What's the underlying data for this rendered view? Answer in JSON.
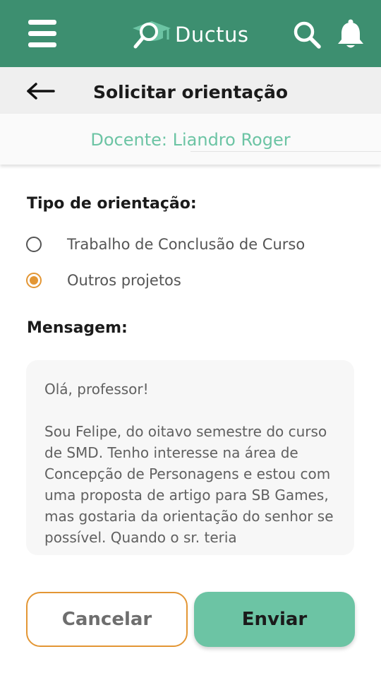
{
  "app": {
    "name": "Ductus"
  },
  "header": {
    "menu_icon": "hamburger-menu-icon",
    "logo_icon": "magnifier-graduation-cap-icon",
    "search_icon": "search-icon",
    "notifications_icon": "bell-icon"
  },
  "page": {
    "back_icon": "arrow-left-icon",
    "title": "Solicitar orientação",
    "teacher": "Docente: Liandro Roger"
  },
  "form": {
    "type_label": "Tipo de orientação:",
    "options": [
      {
        "label": "Trabalho de Conclusão de Curso",
        "selected": false
      },
      {
        "label": "Outros projetos",
        "selected": true
      }
    ],
    "message_label": "Mensagem:",
    "message_value": "Olá, professor!\n\nSou Felipe, do oitavo semestre do curso de SMD. Tenho interesse na área de Concepção de Personagens e estou com uma proposta de artigo para SB Games, mas gostaria da orientação do senhor se possível. Quando o sr. teria"
  },
  "actions": {
    "cancel_label": "Cancelar",
    "send_label": "Enviar"
  },
  "colors": {
    "primary": "#3d8f70",
    "accent_green": "#6cc4a4",
    "accent_orange": "#e39634",
    "title_bar": "#efefef"
  }
}
